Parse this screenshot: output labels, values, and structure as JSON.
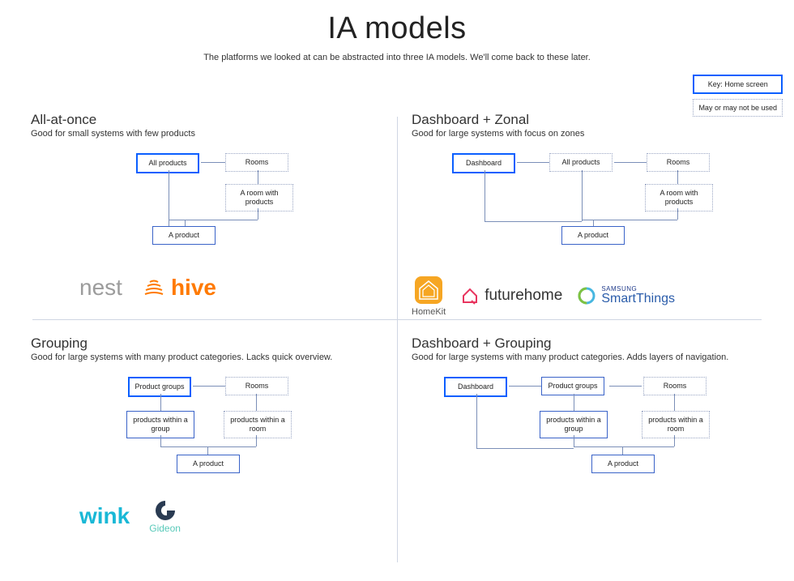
{
  "title": "IA models",
  "subtitle": "The platforms we looked at can be abstracted into three IA models. We'll come back to these later.",
  "key": {
    "home": "Key: Home screen",
    "may": "May or may not be used"
  },
  "quads": {
    "q1": {
      "heading": "All-at-once",
      "sub": "Good for small systems with few products",
      "nodes": {
        "allproducts": "All products",
        "rooms": "Rooms",
        "roomwith": "A room with products",
        "aproduct": "A product"
      },
      "brands": {
        "nest": "nest",
        "hive": "hive"
      }
    },
    "q2": {
      "heading": "Dashboard + Zonal",
      "sub": "Good for large systems with focus on zones",
      "nodes": {
        "dashboard": "Dashboard",
        "allproducts": "All products",
        "rooms": "Rooms",
        "roomwith": "A room with products",
        "aproduct": "A product"
      },
      "brands": {
        "homekit": "HomeKit",
        "futurehome": "futurehome",
        "samsung_prefix": "SAMSUNG",
        "smartthings": "SmartThings"
      }
    },
    "q3": {
      "heading": "Grouping",
      "sub": "Good for large systems with many product categories. Lacks quick overview.",
      "nodes": {
        "groups": "Product groups",
        "rooms": "Rooms",
        "pingroup": "products within a group",
        "pinroom": "products within a room",
        "aproduct": "A product"
      },
      "brands": {
        "wink": "wink",
        "gideon": "Gideon"
      }
    },
    "q4": {
      "heading": "Dashboard + Grouping",
      "sub": "Good for large systems with many product categories. Adds layers of navigation.",
      "nodes": {
        "dashboard": "Dashboard",
        "groups": "Product groups",
        "rooms": "Rooms",
        "pingroup": "products within a group",
        "pinroom": "products within a room",
        "aproduct": "A product"
      }
    }
  }
}
